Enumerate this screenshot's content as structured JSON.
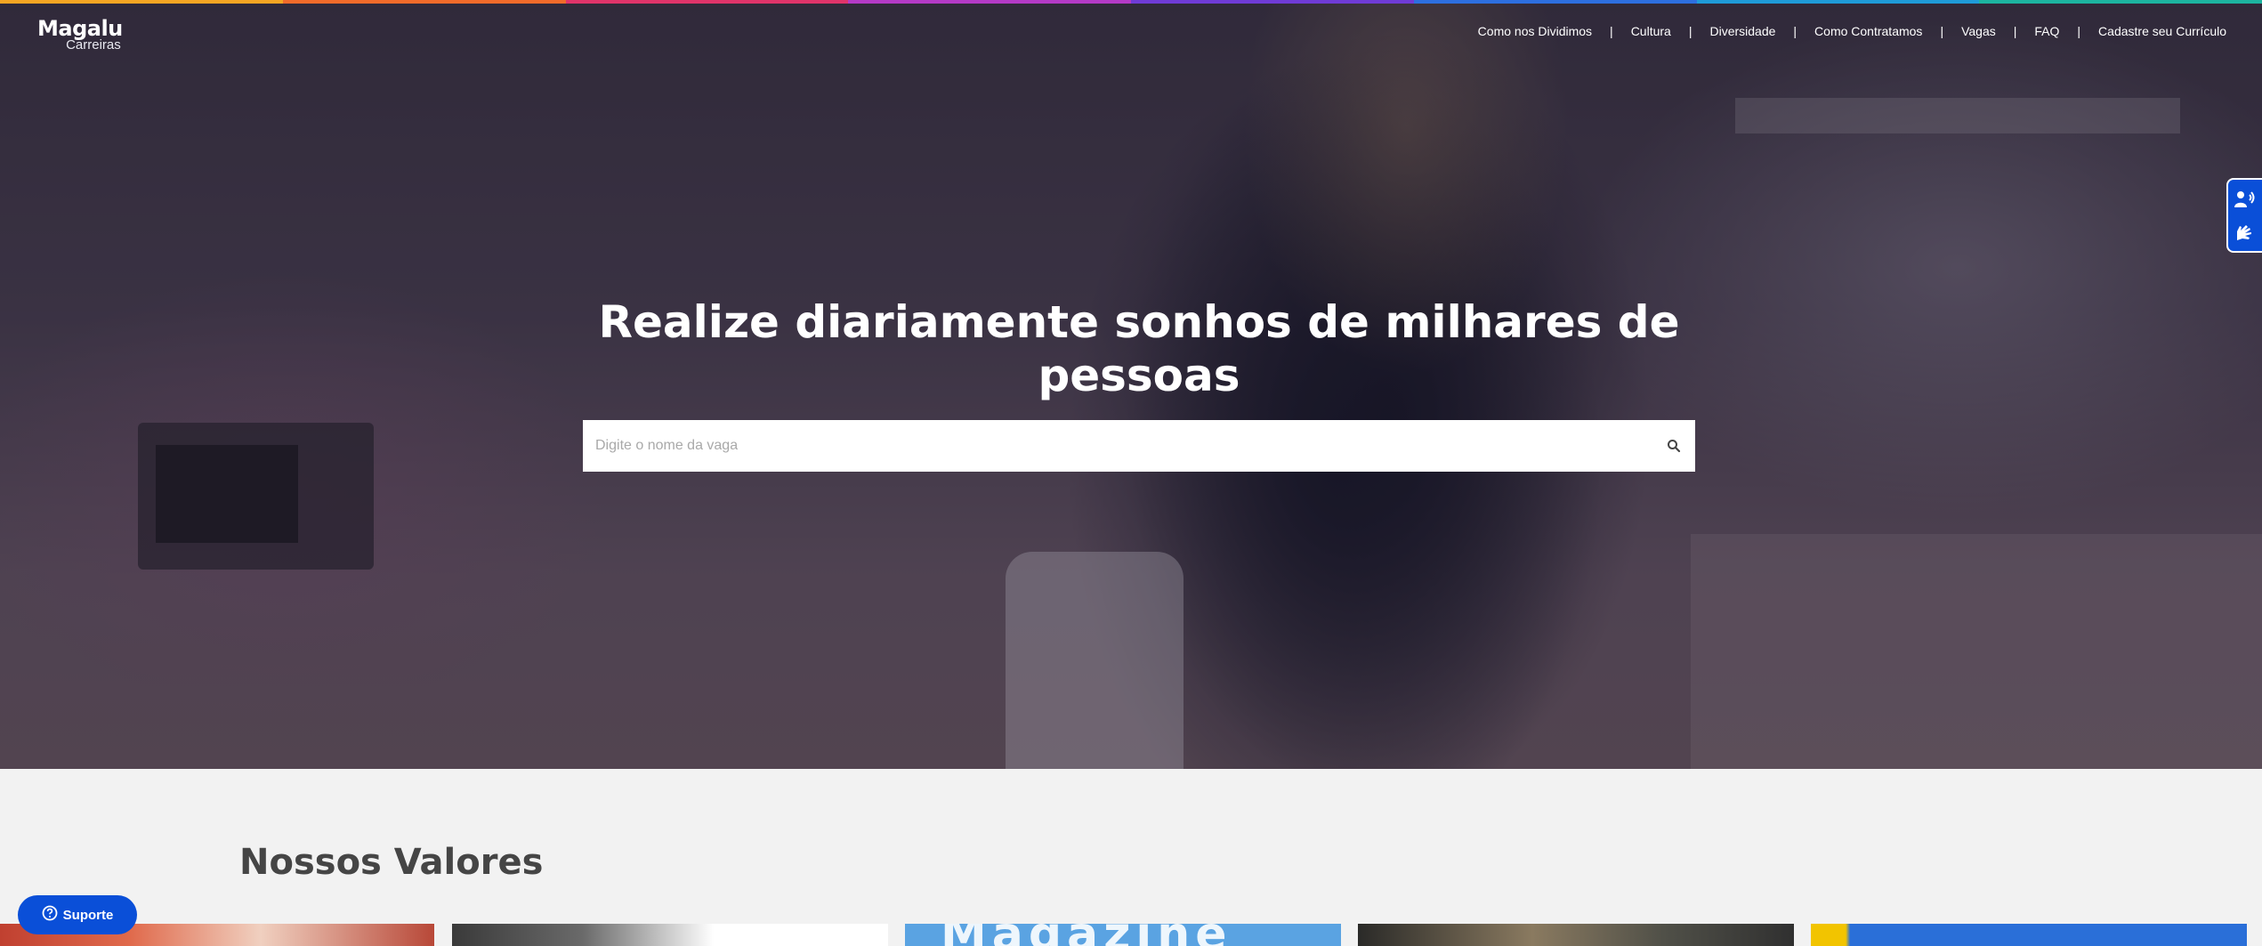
{
  "header": {
    "logo_brand": "Magalu",
    "logo_sub": "Carreiras",
    "nav": [
      {
        "label": "Como nos Dividimos"
      },
      {
        "label": "Cultura"
      },
      {
        "label": "Diversidade"
      },
      {
        "label": "Como Contratamos"
      },
      {
        "label": "Vagas"
      },
      {
        "label": "FAQ"
      },
      {
        "label": "Cadastre seu Currículo"
      }
    ],
    "separator": "|"
  },
  "rainbow_colors": [
    "#f5a623",
    "#f26b2a",
    "#e0346a",
    "#b43ac6",
    "#6f3bd6",
    "#2d6fe0",
    "#1f9bd8",
    "#1db5a0"
  ],
  "hero": {
    "headline_line1": "Realize diariamente sonhos de milhares de",
    "headline_line2": "pessoas",
    "search_placeholder": "Digite o nome da vaga",
    "search_icon": "search-icon"
  },
  "accessibility": {
    "icons": [
      "voice-reader-icon",
      "sign-language-icon"
    ],
    "color": "#0a4fd8"
  },
  "section": {
    "title": "Nossos Valores"
  },
  "cards": {
    "c3_text": "Magazine"
  },
  "support": {
    "label": "Suporte",
    "icon": "help-circle-icon",
    "color": "#0a4fd8"
  }
}
